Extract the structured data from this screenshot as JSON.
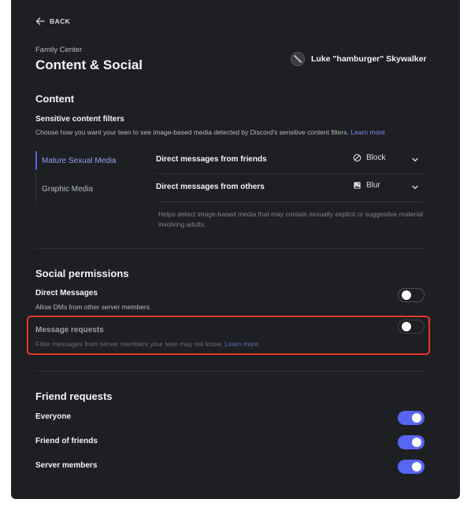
{
  "header": {
    "back_label": "BACK",
    "breadcrumb": "Family Center",
    "title": "Content & Social",
    "user_name": "Luke \"hamburger\" Skywalker"
  },
  "content": {
    "heading": "Content",
    "filters_title": "Sensitive content filters",
    "filters_desc": "Choose how you want your teen to see image-based media detected by Discord's sensitive content filters.",
    "learn_more": "Learn more",
    "tabs": [
      {
        "label": "Mature Sexual Media",
        "active": true
      },
      {
        "label": "Graphic Media",
        "active": false
      }
    ],
    "rows": [
      {
        "label": "Direct messages from friends",
        "value": "Block",
        "icon": "block-icon"
      },
      {
        "label": "Direct messages from others",
        "value": "Blur",
        "icon": "image-icon"
      }
    ],
    "helper_text": "Helps detect image-based media that may contain sexually explicit or suggestive material involving adults."
  },
  "social": {
    "heading": "Social permissions",
    "direct_messages": {
      "title": "Direct Messages",
      "desc": "Allow DMs from other server members",
      "enabled": false
    },
    "message_requests": {
      "title": "Message requests",
      "desc": "Filter messages from server members your teen may not know.",
      "learn_more": "Learn more",
      "enabled": false
    }
  },
  "friends": {
    "heading": "Friend requests",
    "items": [
      {
        "label": "Everyone",
        "enabled": true
      },
      {
        "label": "Friend of friends",
        "enabled": true
      },
      {
        "label": "Server members",
        "enabled": true
      }
    ]
  },
  "colors": {
    "background": "#1e1f22",
    "accent": "#5865f2",
    "highlight": "#e8382a",
    "link": "#7a8cff"
  }
}
